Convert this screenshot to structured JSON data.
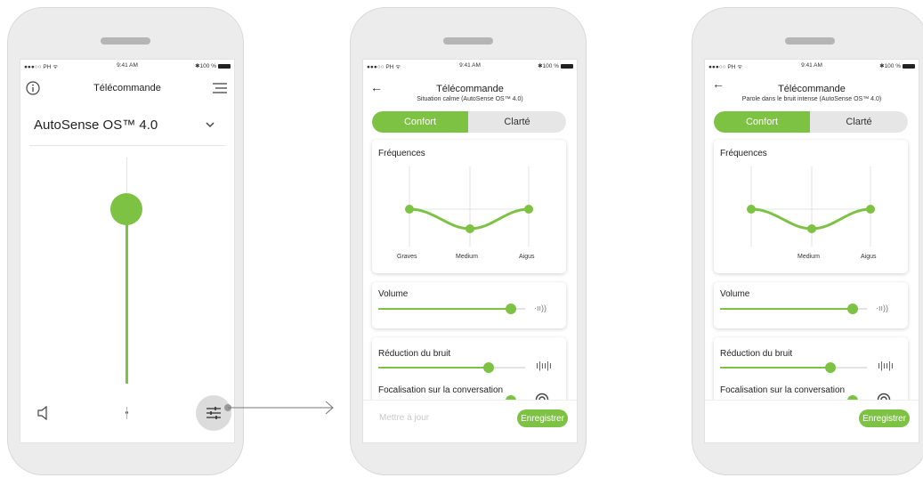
{
  "status_bar": {
    "carrier": "●●●○○ PH ᯤ",
    "time": "9:41 AM",
    "battery": "✱100 %"
  },
  "phone1": {
    "title": "Télécommande",
    "program": "AutoSense OS™ 4.0"
  },
  "phone2": {
    "title": "Télécommande",
    "subtitle": "Situation calme (AutoSense OS™ 4.0)",
    "tabs": [
      "Confort",
      "Clarté"
    ],
    "freq_label": "Fréquences",
    "freq_bands": [
      "Graves",
      "Medium",
      "Aigus"
    ],
    "volume_label": "Volume",
    "volume_level": 0.9,
    "noise_label": "Réduction du bruit",
    "noise_level": 0.75,
    "focus_label": "Focalisation sur la conversation",
    "focus_level": 0.9,
    "update_button": "Mettre à jour",
    "save_button": "Enregistrer"
  },
  "phone3": {
    "title": "Télécommande",
    "subtitle": "Parole dans le bruit intense (AutoSense OS™ 4.0)",
    "tabs": [
      "Confort",
      "Clarté"
    ],
    "freq_label": "Fréquences",
    "freq_bands": [
      "",
      "Medium",
      "Aigus"
    ],
    "volume_label": "Volume",
    "volume_level": 0.9,
    "noise_label": "Réduction du bruit",
    "noise_level": 0.75,
    "focus_label": "Focalisation sur la conversation",
    "focus_level": 0.9,
    "save_button": "Enregistrer"
  },
  "colors": {
    "accent": "#7dc243",
    "phone_body": "#ececec"
  }
}
